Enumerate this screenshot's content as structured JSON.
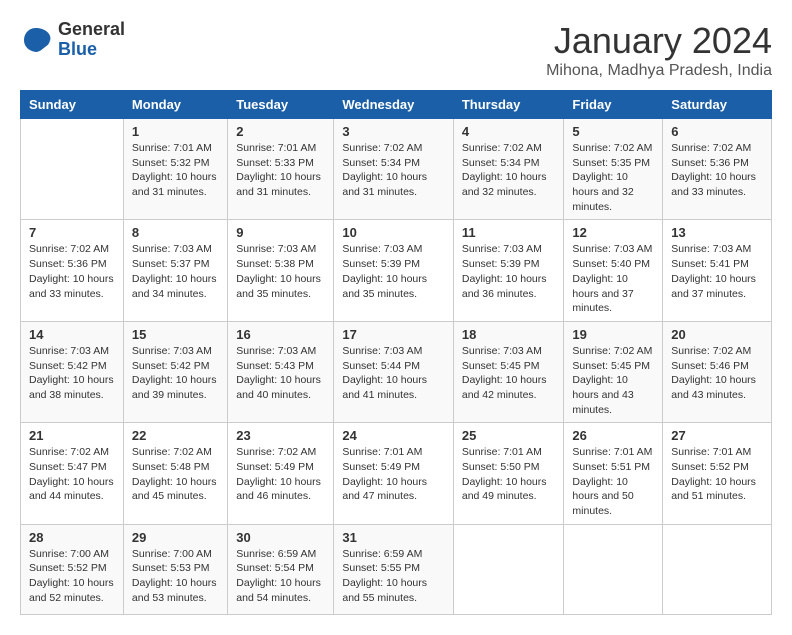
{
  "logo": {
    "general": "General",
    "blue": "Blue"
  },
  "header": {
    "month": "January 2024",
    "location": "Mihona, Madhya Pradesh, India"
  },
  "weekdays": [
    "Sunday",
    "Monday",
    "Tuesday",
    "Wednesday",
    "Thursday",
    "Friday",
    "Saturday"
  ],
  "weeks": [
    [
      {
        "day": "",
        "sunrise": "",
        "sunset": "",
        "daylight": ""
      },
      {
        "day": "1",
        "sunrise": "Sunrise: 7:01 AM",
        "sunset": "Sunset: 5:32 PM",
        "daylight": "Daylight: 10 hours and 31 minutes."
      },
      {
        "day": "2",
        "sunrise": "Sunrise: 7:01 AM",
        "sunset": "Sunset: 5:33 PM",
        "daylight": "Daylight: 10 hours and 31 minutes."
      },
      {
        "day": "3",
        "sunrise": "Sunrise: 7:02 AM",
        "sunset": "Sunset: 5:34 PM",
        "daylight": "Daylight: 10 hours and 31 minutes."
      },
      {
        "day": "4",
        "sunrise": "Sunrise: 7:02 AM",
        "sunset": "Sunset: 5:34 PM",
        "daylight": "Daylight: 10 hours and 32 minutes."
      },
      {
        "day": "5",
        "sunrise": "Sunrise: 7:02 AM",
        "sunset": "Sunset: 5:35 PM",
        "daylight": "Daylight: 10 hours and 32 minutes."
      },
      {
        "day": "6",
        "sunrise": "Sunrise: 7:02 AM",
        "sunset": "Sunset: 5:36 PM",
        "daylight": "Daylight: 10 hours and 33 minutes."
      }
    ],
    [
      {
        "day": "7",
        "sunrise": "Sunrise: 7:02 AM",
        "sunset": "Sunset: 5:36 PM",
        "daylight": "Daylight: 10 hours and 33 minutes."
      },
      {
        "day": "8",
        "sunrise": "Sunrise: 7:03 AM",
        "sunset": "Sunset: 5:37 PM",
        "daylight": "Daylight: 10 hours and 34 minutes."
      },
      {
        "day": "9",
        "sunrise": "Sunrise: 7:03 AM",
        "sunset": "Sunset: 5:38 PM",
        "daylight": "Daylight: 10 hours and 35 minutes."
      },
      {
        "day": "10",
        "sunrise": "Sunrise: 7:03 AM",
        "sunset": "Sunset: 5:39 PM",
        "daylight": "Daylight: 10 hours and 35 minutes."
      },
      {
        "day": "11",
        "sunrise": "Sunrise: 7:03 AM",
        "sunset": "Sunset: 5:39 PM",
        "daylight": "Daylight: 10 hours and 36 minutes."
      },
      {
        "day": "12",
        "sunrise": "Sunrise: 7:03 AM",
        "sunset": "Sunset: 5:40 PM",
        "daylight": "Daylight: 10 hours and 37 minutes."
      },
      {
        "day": "13",
        "sunrise": "Sunrise: 7:03 AM",
        "sunset": "Sunset: 5:41 PM",
        "daylight": "Daylight: 10 hours and 37 minutes."
      }
    ],
    [
      {
        "day": "14",
        "sunrise": "Sunrise: 7:03 AM",
        "sunset": "Sunset: 5:42 PM",
        "daylight": "Daylight: 10 hours and 38 minutes."
      },
      {
        "day": "15",
        "sunrise": "Sunrise: 7:03 AM",
        "sunset": "Sunset: 5:42 PM",
        "daylight": "Daylight: 10 hours and 39 minutes."
      },
      {
        "day": "16",
        "sunrise": "Sunrise: 7:03 AM",
        "sunset": "Sunset: 5:43 PM",
        "daylight": "Daylight: 10 hours and 40 minutes."
      },
      {
        "day": "17",
        "sunrise": "Sunrise: 7:03 AM",
        "sunset": "Sunset: 5:44 PM",
        "daylight": "Daylight: 10 hours and 41 minutes."
      },
      {
        "day": "18",
        "sunrise": "Sunrise: 7:03 AM",
        "sunset": "Sunset: 5:45 PM",
        "daylight": "Daylight: 10 hours and 42 minutes."
      },
      {
        "day": "19",
        "sunrise": "Sunrise: 7:02 AM",
        "sunset": "Sunset: 5:45 PM",
        "daylight": "Daylight: 10 hours and 43 minutes."
      },
      {
        "day": "20",
        "sunrise": "Sunrise: 7:02 AM",
        "sunset": "Sunset: 5:46 PM",
        "daylight": "Daylight: 10 hours and 43 minutes."
      }
    ],
    [
      {
        "day": "21",
        "sunrise": "Sunrise: 7:02 AM",
        "sunset": "Sunset: 5:47 PM",
        "daylight": "Daylight: 10 hours and 44 minutes."
      },
      {
        "day": "22",
        "sunrise": "Sunrise: 7:02 AM",
        "sunset": "Sunset: 5:48 PM",
        "daylight": "Daylight: 10 hours and 45 minutes."
      },
      {
        "day": "23",
        "sunrise": "Sunrise: 7:02 AM",
        "sunset": "Sunset: 5:49 PM",
        "daylight": "Daylight: 10 hours and 46 minutes."
      },
      {
        "day": "24",
        "sunrise": "Sunrise: 7:01 AM",
        "sunset": "Sunset: 5:49 PM",
        "daylight": "Daylight: 10 hours and 47 minutes."
      },
      {
        "day": "25",
        "sunrise": "Sunrise: 7:01 AM",
        "sunset": "Sunset: 5:50 PM",
        "daylight": "Daylight: 10 hours and 49 minutes."
      },
      {
        "day": "26",
        "sunrise": "Sunrise: 7:01 AM",
        "sunset": "Sunset: 5:51 PM",
        "daylight": "Daylight: 10 hours and 50 minutes."
      },
      {
        "day": "27",
        "sunrise": "Sunrise: 7:01 AM",
        "sunset": "Sunset: 5:52 PM",
        "daylight": "Daylight: 10 hours and 51 minutes."
      }
    ],
    [
      {
        "day": "28",
        "sunrise": "Sunrise: 7:00 AM",
        "sunset": "Sunset: 5:52 PM",
        "daylight": "Daylight: 10 hours and 52 minutes."
      },
      {
        "day": "29",
        "sunrise": "Sunrise: 7:00 AM",
        "sunset": "Sunset: 5:53 PM",
        "daylight": "Daylight: 10 hours and 53 minutes."
      },
      {
        "day": "30",
        "sunrise": "Sunrise: 6:59 AM",
        "sunset": "Sunset: 5:54 PM",
        "daylight": "Daylight: 10 hours and 54 minutes."
      },
      {
        "day": "31",
        "sunrise": "Sunrise: 6:59 AM",
        "sunset": "Sunset: 5:55 PM",
        "daylight": "Daylight: 10 hours and 55 minutes."
      },
      {
        "day": "",
        "sunrise": "",
        "sunset": "",
        "daylight": ""
      },
      {
        "day": "",
        "sunrise": "",
        "sunset": "",
        "daylight": ""
      },
      {
        "day": "",
        "sunrise": "",
        "sunset": "",
        "daylight": ""
      }
    ]
  ]
}
